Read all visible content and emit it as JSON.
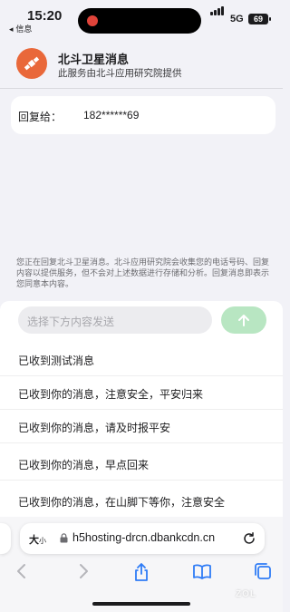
{
  "status": {
    "time": "15:20",
    "back_app": "◂ 信息",
    "network": "5G",
    "battery": "69"
  },
  "header": {
    "title": "北斗卫星消息",
    "subtitle": "此服务由北斗应用研究院提供",
    "logo_icon": "satellite-icon",
    "logo_color": "#e9683a"
  },
  "reply": {
    "label": "回复给：",
    "number": "182******69"
  },
  "notice": "您正在回复北斗卫星消息。北斗应用研究院会收集您的电话号码、回复内容以提供服务，但不会对上述数据进行存储和分析。回复消息即表示您同意本内容。",
  "composer": {
    "placeholder": "选择下方内容发送",
    "send_icon": "arrow-up-icon",
    "send_color": "#b8e6c2"
  },
  "options": [
    "已收到测试消息",
    "已收到你的消息，注意安全，平安归来",
    "已收到你的消息，请及时报平安",
    "已收到你的消息，早点回来",
    "已收到你的消息，在山脚下等你，注意安全"
  ],
  "browser": {
    "text_size_big": "大",
    "text_size_small": "小",
    "url": "h5hosting-drcn.dbankcdn.cn"
  },
  "watermark": "ZOL"
}
